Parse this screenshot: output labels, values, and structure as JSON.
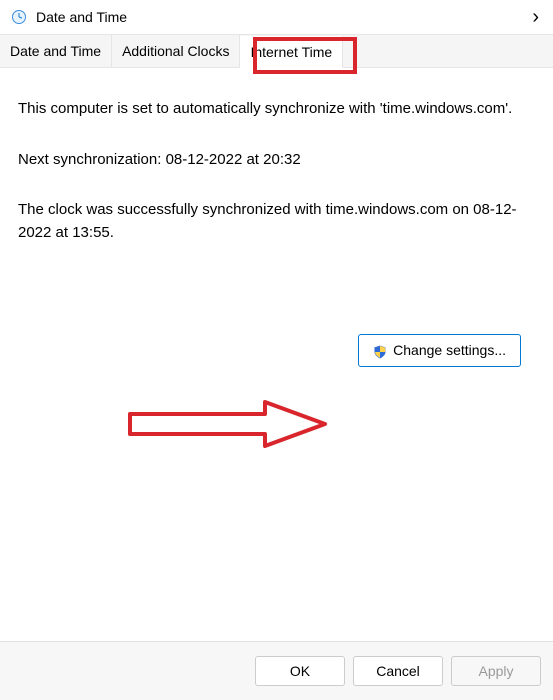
{
  "window": {
    "title": "Date and Time"
  },
  "tabs": {
    "date_time": "Date and Time",
    "additional_clocks": "Additional Clocks",
    "internet_time": "Internet Time"
  },
  "body": {
    "sync_info": "This computer is set to automatically synchronize with 'time.windows.com'.",
    "next_sync": "Next synchronization: 08-12-2022 at 20:32",
    "last_sync": "The clock was successfully synchronized with time.windows.com on 08-12-2022 at 13:55.",
    "change_settings_label": "Change settings..."
  },
  "buttons": {
    "ok": "OK",
    "cancel": "Cancel",
    "apply": "Apply"
  }
}
